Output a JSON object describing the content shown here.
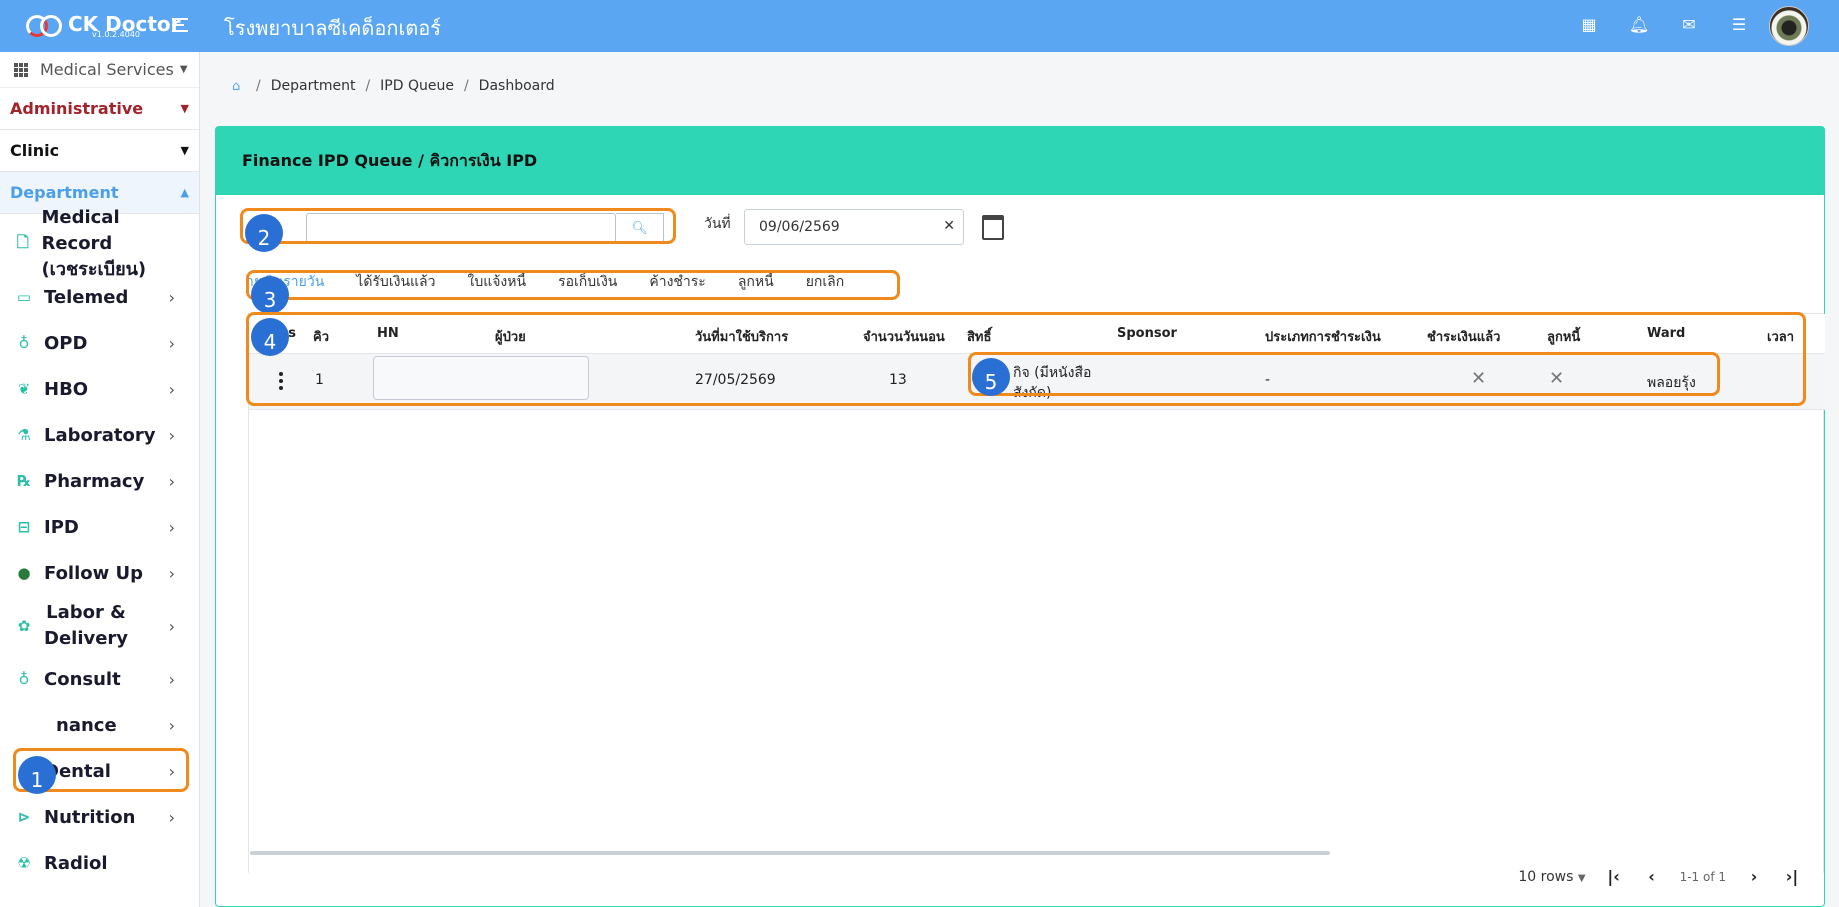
{
  "app": {
    "name": "CK Doctor",
    "version": "v1.0.2.4040",
    "hospital": "โรงพยาบาลซีเคด็อกเตอร์"
  },
  "sidebar": {
    "service_selector": "Medical Services",
    "sections": {
      "administrative": "Administrative",
      "clinic": "Clinic",
      "department": "Department"
    },
    "items": [
      {
        "label": "Medical Record\n(เวชระเบียน)"
      },
      {
        "label": "Telemed"
      },
      {
        "label": "OPD"
      },
      {
        "label": "HBO"
      },
      {
        "label": "Laboratory"
      },
      {
        "label": "Pharmacy"
      },
      {
        "label": "IPD"
      },
      {
        "label": "Follow Up"
      },
      {
        "label": "Labor &\nDelivery"
      },
      {
        "label": "Consult"
      },
      {
        "label": "nance"
      },
      {
        "label": "Dental"
      },
      {
        "label": "Nutrition"
      },
      {
        "label": "Radiol"
      }
    ]
  },
  "breadcrumb": [
    "Department",
    "IPD Queue",
    "Dashboard"
  ],
  "card": {
    "title": "Finance IPD Queue / คิวการเงิน IPD"
  },
  "filters": {
    "search_placeholder": "",
    "date_label": "วันที่",
    "date_value": "09/06/2569"
  },
  "tabs": [
    "ายเงินรายวัน",
    "ได้รับเงินแล้ว",
    "ใบแจ้งหนี้",
    "รอเก็บเงิน",
    "ค้างชำระ",
    "ลูกหนี้",
    "ยกเลิก"
  ],
  "table": {
    "headers": [
      "ns",
      "คิว",
      "HN",
      "ผู้ป่วย",
      "วันที่มาใช้บริการ",
      "จำนวนวันนอน",
      "สิทธิ์",
      "Sponsor",
      "ประเภทการชำระเงิน",
      "ชำระเงินแล้ว",
      "ลูกหนี้",
      "Ward",
      "เวลา"
    ],
    "rows": [
      {
        "queue": "1",
        "service_date": "27/05/2569",
        "nights": "13",
        "right_line1": "กิจ (มีหนังสือ",
        "right_line2": "สังกัด)",
        "payment_type": "-",
        "ward": "พลอยรุ้ง"
      }
    ]
  },
  "pagination": {
    "rows_per_page": "10 rows",
    "range": "1-1 of 1"
  },
  "annotations": [
    "1",
    "2",
    "3",
    "4",
    "5"
  ],
  "colors": {
    "topbar": "#5aa6f2",
    "card_header": "#2fd6b6",
    "annotation": "#f08a1c",
    "badge": "#2a6fd4",
    "admin": "#a3232b",
    "department": "#4a9fe8"
  }
}
